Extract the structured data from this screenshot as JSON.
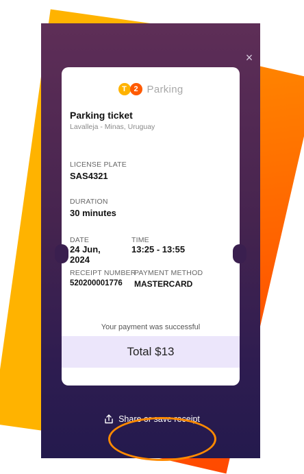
{
  "colors": {
    "yellow_card": "#ffb300",
    "orange_card": "#ff5a00",
    "screen_top": "#5e2e57",
    "screen_bottom": "#241a4d",
    "total_band": "#ece6fb",
    "highlight_ring": "#ff8a00"
  },
  "logo": {
    "badge_t": "T",
    "badge_2": "2",
    "text": "Parking"
  },
  "ticket": {
    "title": "Parking ticket",
    "location": "Lavalleja - Minas, Uruguay",
    "license_label": "LICENSE PLATE",
    "license_value": "SAS4321",
    "duration_label": "DURATION",
    "duration_value": "30 minutes",
    "date_label": "DATE",
    "date_value": "24 Jun, 2024",
    "time_label": "TIME",
    "time_value": "13:25 - 13:55",
    "receipt_label": "RECEIPT NUMBER",
    "receipt_value": "520200001776",
    "payment_label": "PAYMENT METHOD",
    "payment_value": "MASTERCARD",
    "success_text": "Your payment was successful",
    "total": "Total $13"
  },
  "close_label": "×",
  "share_label": "Share or save receipt"
}
